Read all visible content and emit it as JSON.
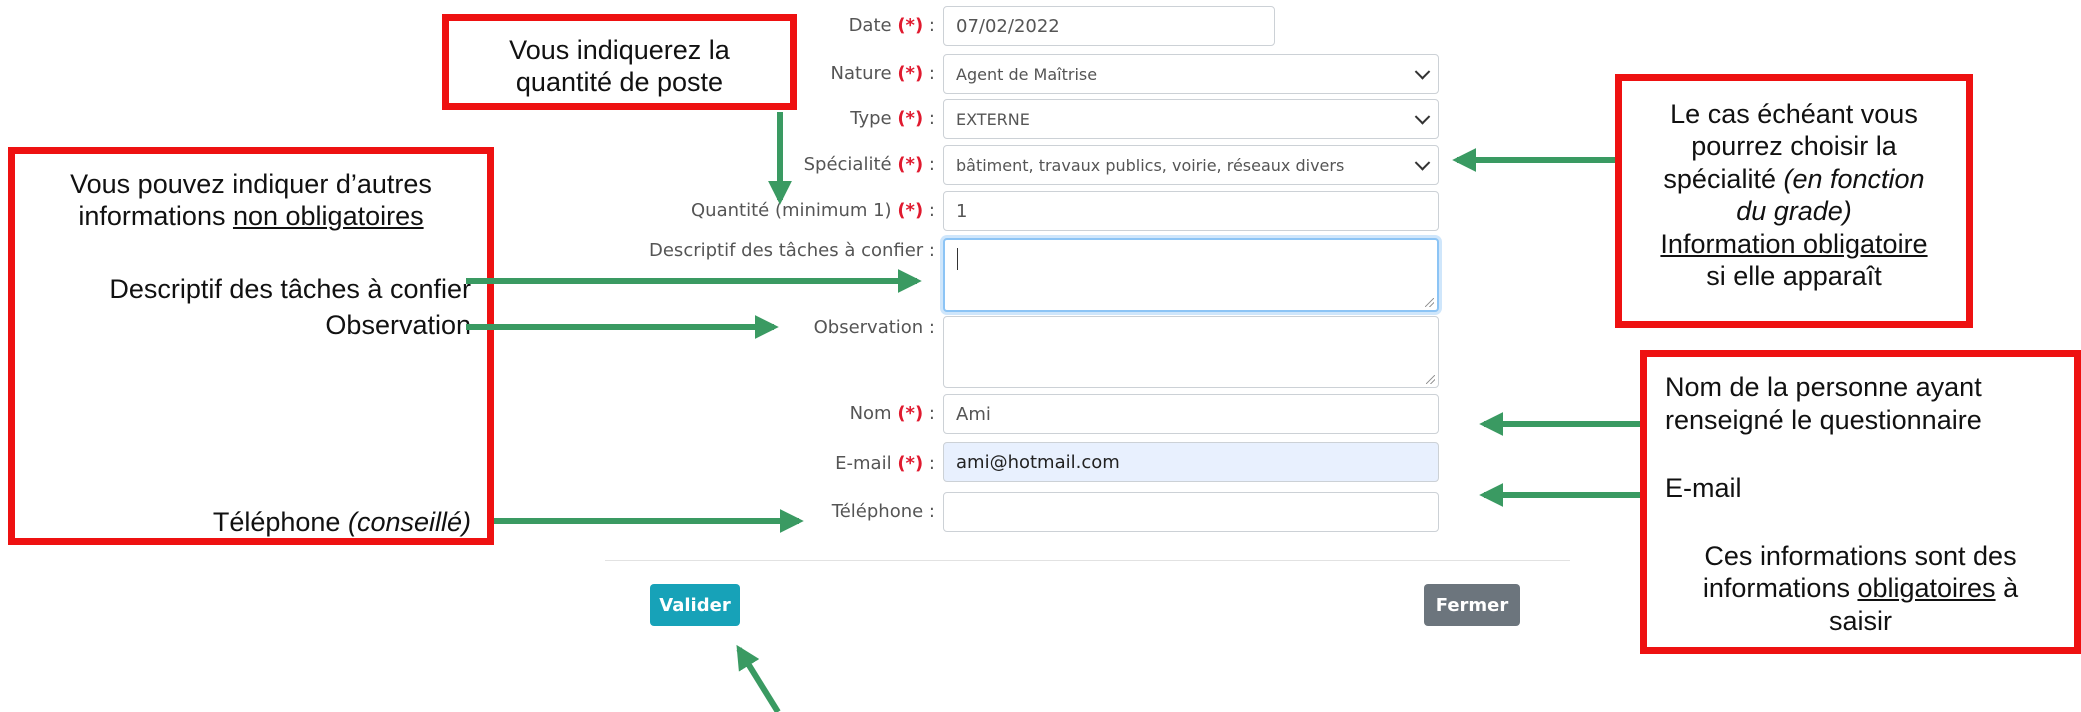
{
  "required_mark": "(*)",
  "form": {
    "date": {
      "label": "Date",
      "value": "07/02/2022"
    },
    "nature": {
      "label": "Nature",
      "value": "Agent de Maîtrise"
    },
    "type": {
      "label": "Type",
      "value": "EXTERNE"
    },
    "specialite": {
      "label": "Spécialité",
      "value": "bâtiment, travaux publics, voirie, réseaux divers"
    },
    "quantite": {
      "label": "Quantité (minimum 1)",
      "value": "1"
    },
    "descriptif": {
      "label": "Descriptif des tâches à confier :",
      "value": ""
    },
    "observation": {
      "label": "Observation :",
      "value": ""
    },
    "nom": {
      "label": "Nom",
      "value": "Ami"
    },
    "email": {
      "label": "E-mail",
      "value": "ami@hotmail.com"
    },
    "telephone": {
      "label": "Téléphone :",
      "value": ""
    }
  },
  "buttons": {
    "valider": "Valider",
    "fermer": "Fermer"
  },
  "annotations": {
    "quantite_box": {
      "line1": "Vous indiquerez la",
      "line2": "quantité de poste"
    },
    "left_box": {
      "line1": "Vous pouvez indiquer d’autres",
      "line2_prefix": "informations ",
      "line2_underlined": "non obligatoires",
      "descriptif": "Descriptif des tâches à confier",
      "observation": "Observation",
      "telephone_prefix": "Téléphone ",
      "telephone_italic": "(conseillé)"
    },
    "specialite_box": {
      "line1": "Le cas échéant vous",
      "line2": "pourrez choisir la",
      "line3_prefix": "spécialité ",
      "line3_italic": "(en fonction",
      "line4_italic": "du grade)",
      "line5_underlined": "Information obligatoire",
      "line6": "si elle apparaît"
    },
    "nom_box": {
      "line1": "Nom de la personne ayant",
      "line2": "renseigné le questionnaire",
      "email": "E-mail",
      "info1": "Ces informations sont des",
      "info2_prefix": "informations ",
      "info2_underlined": "obligatoires",
      "info2_suffix": " à",
      "info3": "saisir"
    }
  },
  "colors": {
    "accent_red": "#ee1111",
    "arrow_green": "#3a9a62",
    "valider_bg": "#17a2b8",
    "fermer_bg": "#6c757d",
    "required_red": "#e0192e"
  }
}
